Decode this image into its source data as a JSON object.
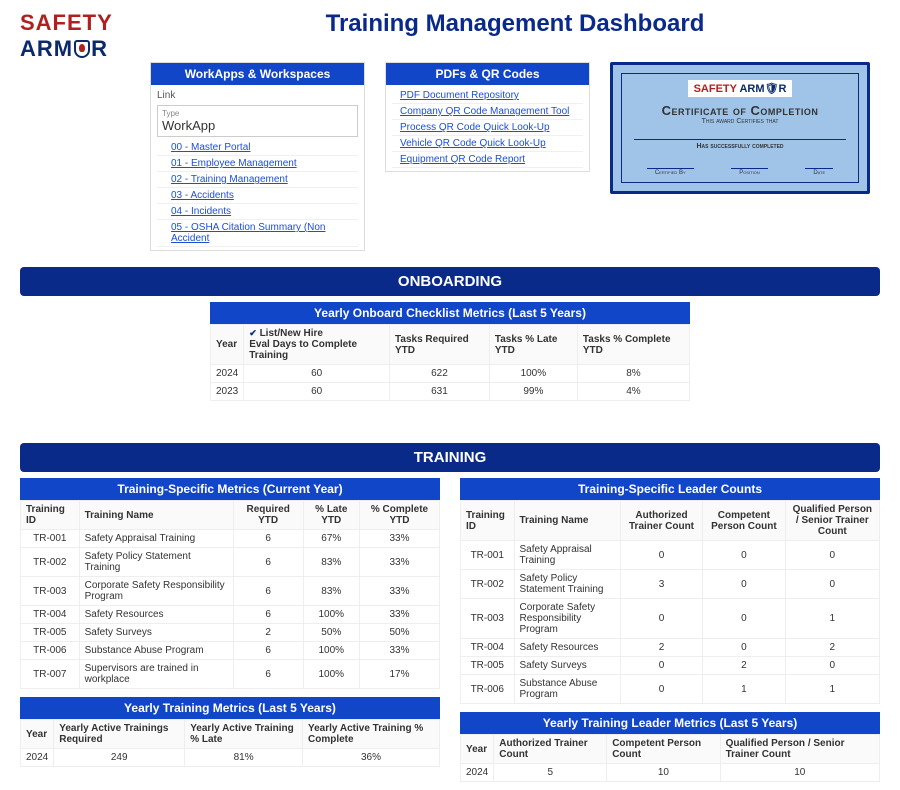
{
  "logo": {
    "line1": "SAFETY",
    "line2a": "ARM",
    "line2b": "R"
  },
  "page_title": "Training Management Dashboard",
  "workapps": {
    "header": "WorkApps & Workspaces",
    "link_label": "Link",
    "type_label": "Type",
    "type_value": "WorkApp",
    "links": [
      "00 - Master Portal",
      "01 - Employee Management",
      "02 - Training Management",
      "03 - Accidents",
      "04 - Incidents",
      "05 - OSHA Citation Summary (Non Accident"
    ]
  },
  "pdfqr": {
    "header": "PDFs & QR Codes",
    "links": [
      "PDF Document Repository",
      "Company QR Code Management Tool",
      "Process QR Code Quick Look-Up",
      "Vehicle QR Code Quick Look-Up",
      "Equipment QR Code Report"
    ]
  },
  "certificate": {
    "brand1": "SAFETY",
    "brand2": "ARM🛡R",
    "title": "Certificate of Completion",
    "sub": "This award Certifies that",
    "line": "Has successfully completed",
    "sigs": [
      "Certified By",
      "Position",
      "Date"
    ]
  },
  "onboarding": {
    "section": "ONBOARDING",
    "sub_header": "Yearly Onboard Checklist Metrics (Last 5 Years)",
    "check_label": "List/New Hire",
    "cols": [
      "Year",
      "Eval Days to Complete Training",
      "Tasks Required YTD",
      "Tasks % Late YTD",
      "Tasks % Complete YTD"
    ],
    "rows": [
      {
        "year": "2024",
        "days": "60",
        "req": "622",
        "late": "100%",
        "comp": "8%"
      },
      {
        "year": "2023",
        "days": "60",
        "req": "631",
        "late": "99%",
        "comp": "4%"
      }
    ]
  },
  "training": {
    "section": "TRAINING",
    "specific": {
      "header": "Training-Specific Metrics (Current Year)",
      "cols": [
        "Training ID",
        "Training Name",
        "Required YTD",
        "% Late YTD",
        "% Complete YTD"
      ],
      "rows": [
        {
          "id": "TR-001",
          "name": "Safety Appraisal Training",
          "req": "6",
          "late": "67%",
          "comp": "33%"
        },
        {
          "id": "TR-002",
          "name": "Safety Policy Statement Training",
          "req": "6",
          "late": "83%",
          "comp": "33%"
        },
        {
          "id": "TR-003",
          "name": "Corporate Safety Responsibility Program",
          "req": "6",
          "late": "83%",
          "comp": "33%"
        },
        {
          "id": "TR-004",
          "name": "Safety Resources",
          "req": "6",
          "late": "100%",
          "comp": "33%"
        },
        {
          "id": "TR-005",
          "name": "Safety Surveys",
          "req": "2",
          "late": "50%",
          "comp": "50%"
        },
        {
          "id": "TR-006",
          "name": "Substance Abuse Program",
          "req": "6",
          "late": "100%",
          "comp": "33%"
        },
        {
          "id": "TR-007",
          "name": "Supervisors are trained in workplace",
          "req": "6",
          "late": "100%",
          "comp": "17%"
        }
      ]
    },
    "yearly": {
      "header": "Yearly Training Metrics (Last 5 Years)",
      "cols": [
        "Year",
        "Yearly Active Trainings Required",
        "Yearly Active Training % Late",
        "Yearly Active Training % Complete"
      ],
      "rows": [
        {
          "year": "2024",
          "req": "249",
          "late": "81%",
          "comp": "36%"
        }
      ]
    },
    "leaders": {
      "header": "Training-Specific Leader Counts",
      "cols": [
        "Training ID",
        "Training Name",
        "Authorized Trainer Count",
        "Competent Person Count",
        "Qualified Person / Senior Trainer Count"
      ],
      "rows": [
        {
          "id": "TR-001",
          "name": "Safety Appraisal Training",
          "a": "0",
          "b": "0",
          "c": "0"
        },
        {
          "id": "TR-002",
          "name": "Safety Policy Statement Training",
          "a": "3",
          "b": "0",
          "c": "0"
        },
        {
          "id": "TR-003",
          "name": "Corporate Safety Responsibility Program",
          "a": "0",
          "b": "0",
          "c": "1"
        },
        {
          "id": "TR-004",
          "name": "Safety Resources",
          "a": "2",
          "b": "0",
          "c": "2"
        },
        {
          "id": "TR-005",
          "name": "Safety Surveys",
          "a": "0",
          "b": "2",
          "c": "0"
        },
        {
          "id": "TR-006",
          "name": "Substance Abuse Program",
          "a": "0",
          "b": "1",
          "c": "1"
        }
      ]
    },
    "yearly_leaders": {
      "header": "Yearly Training Leader Metrics (Last 5 Years)",
      "cols": [
        "Year",
        "Authorized Trainer Count",
        "Competent Person Count",
        "Qualified Person / Senior Trainer Count"
      ],
      "rows": [
        {
          "year": "2024",
          "a": "5",
          "b": "10",
          "c": "10"
        }
      ]
    }
  }
}
